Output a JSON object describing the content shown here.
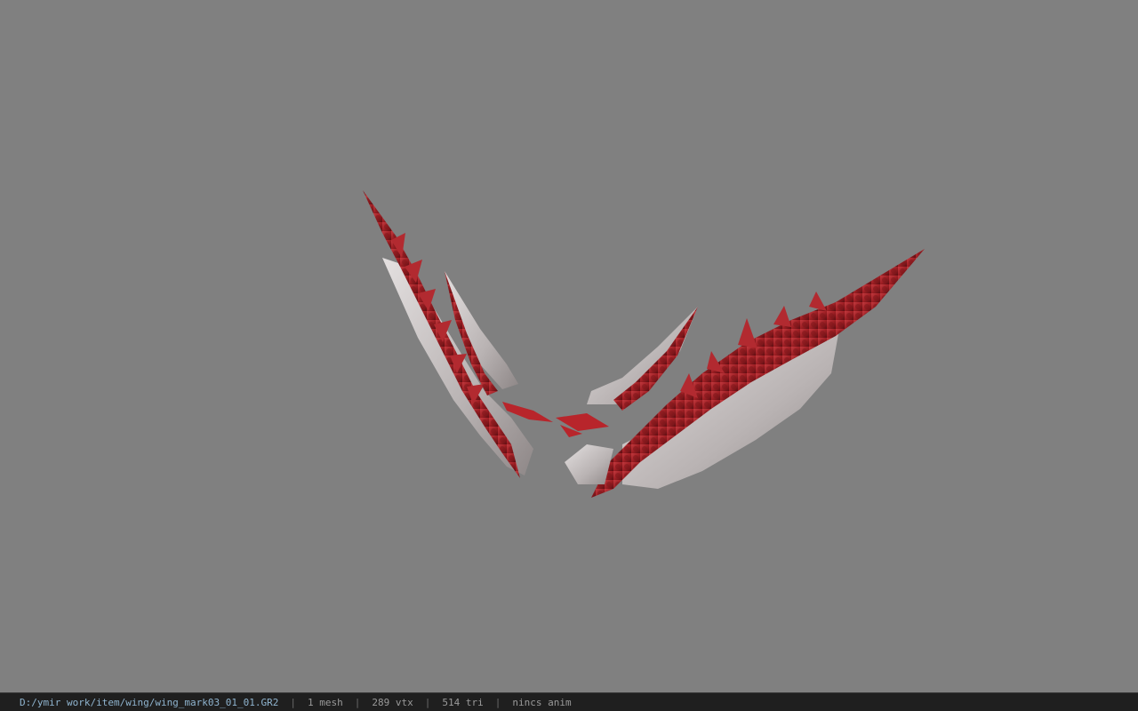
{
  "viewport": {
    "background_color": "#808080",
    "model_primary_color": "#9e1f24",
    "model_secondary_color": "#d8d4d4"
  },
  "statusbar": {
    "file_path": "D:/ymir work/item/wing/wing_mark03_01_01.GR2",
    "separator": "|",
    "mesh_count": "1 mesh",
    "vertex_count": "289 vtx",
    "triangle_count": "514 tri",
    "anim_status": "nincs anim"
  }
}
